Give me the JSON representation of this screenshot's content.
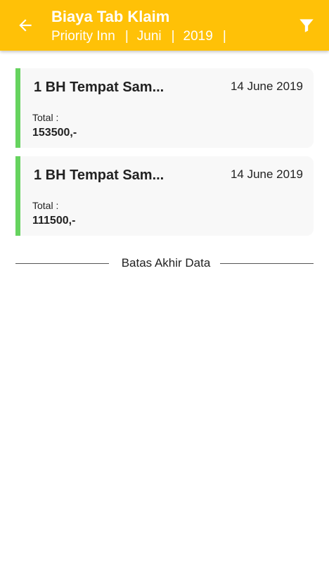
{
  "appbar": {
    "title": "Biaya Tab Klaim",
    "subtitle": {
      "hotel": "Priority Inn",
      "month": "Juni",
      "year": "2019",
      "separator": "|"
    },
    "background_color": "#FFC107",
    "back_icon": "arrow-left-icon",
    "filter_icon": "filter-funnel-icon"
  },
  "claims": [
    {
      "name": "1 BH Tempat Sam...",
      "date": "14 June 2019",
      "total_label": "Total :",
      "total_value": "153500,-"
    },
    {
      "name": "1 BH Tempat Sam...",
      "date": "14 June 2019",
      "total_label": "Total :",
      "total_value": "111500,-"
    }
  ],
  "card_accent_color": "#66D35F",
  "end_of_data_label": "Batas Akhir Data"
}
